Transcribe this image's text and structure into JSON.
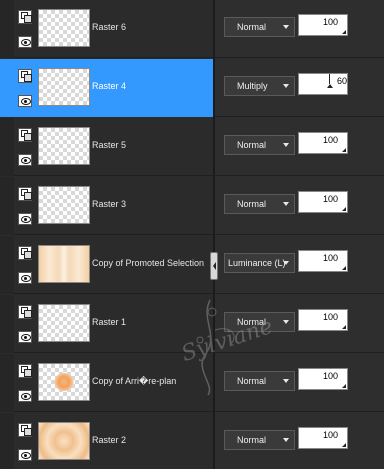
{
  "layers": [
    {
      "name": "Raster 6",
      "thumb": "transparent",
      "blend": "Normal",
      "opacity": "100",
      "selected": false
    },
    {
      "name": "Raster 4",
      "thumb": "transparent",
      "blend": "Multiply",
      "opacity": "60",
      "selected": true
    },
    {
      "name": "Raster 5",
      "thumb": "transparent",
      "blend": "Normal",
      "opacity": "100",
      "selected": false
    },
    {
      "name": "Raster 3",
      "thumb": "transparent",
      "blend": "Normal",
      "opacity": "100",
      "selected": false
    },
    {
      "name": "Copy of Promoted Selection",
      "thumb": "peach",
      "blend": "Luminance (L)",
      "opacity": "100",
      "selected": false
    },
    {
      "name": "Raster 1",
      "thumb": "transparent",
      "blend": "Normal",
      "opacity": "100",
      "selected": false
    },
    {
      "name": "Copy of Arri�re-plan",
      "thumb": "flower",
      "blend": "Normal",
      "opacity": "100",
      "selected": false
    },
    {
      "name": "Raster 2",
      "thumb": "kaleido",
      "blend": "Normal",
      "opacity": "100",
      "selected": false
    }
  ],
  "watermark": "Sylviane",
  "icons": {
    "group": "layer-group-icon",
    "visibility": "eye-icon",
    "dropdown": "chevron-down-icon"
  },
  "colors": {
    "selected_row": "#3399ff",
    "panel_bg": "#2b2b2b"
  }
}
